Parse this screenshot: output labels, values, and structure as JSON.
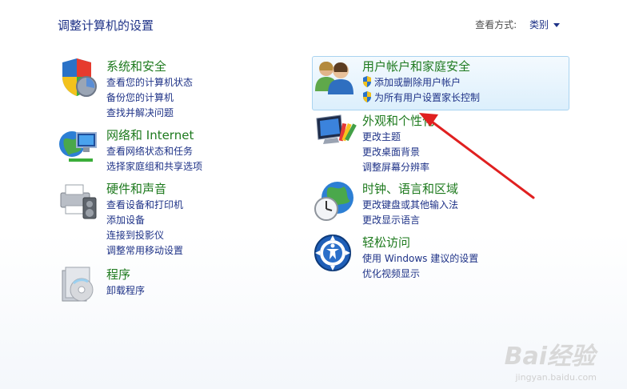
{
  "header": {
    "title": "调整计算机的设置",
    "view_by_label": "查看方式:",
    "view_by_value": "类别"
  },
  "categories": [
    {
      "icon": "shield-security-icon",
      "heading": "系统和安全",
      "links": [
        "查看您的计算机状态",
        "备份您的计算机",
        "查找并解决问题"
      ]
    },
    {
      "icon": "network-globe-icon",
      "heading": "网络和 Internet",
      "links": [
        "查看网络状态和任务",
        "选择家庭组和共享选项"
      ]
    },
    {
      "icon": "printer-hardware-icon",
      "heading": "硬件和声音",
      "links": [
        "查看设备和打印机",
        "添加设备",
        "连接到投影仪",
        "调整常用移动设置"
      ]
    },
    {
      "icon": "programs-disc-icon",
      "heading": "程序",
      "links": [
        "卸载程序"
      ]
    },
    {
      "icon": "users-icon",
      "heading": "用户帐户和家庭安全",
      "links": [
        "添加或删除用户帐户",
        "为所有用户设置家长控制"
      ]
    },
    {
      "icon": "appearance-monitor-icon",
      "heading": "外观和个性化",
      "links": [
        "更改主题",
        "更改桌面背景",
        "调整屏幕分辨率"
      ]
    },
    {
      "icon": "clock-globe-icon",
      "heading": "时钟、语言和区域",
      "links": [
        "更改键盘或其他输入法",
        "更改显示语言"
      ]
    },
    {
      "icon": "ease-of-access-icon",
      "heading": "轻松访问",
      "links": [
        "使用 Windows 建议的设置",
        "优化视频显示"
      ]
    }
  ],
  "watermark": {
    "brand": "Bai经验",
    "url": "jingyan.baidu.com"
  },
  "colors": {
    "heading": "#1e7a1e",
    "link": "#1e3287",
    "highlight_border": "#a9d3f0",
    "annotation_arrow": "#e02020"
  }
}
